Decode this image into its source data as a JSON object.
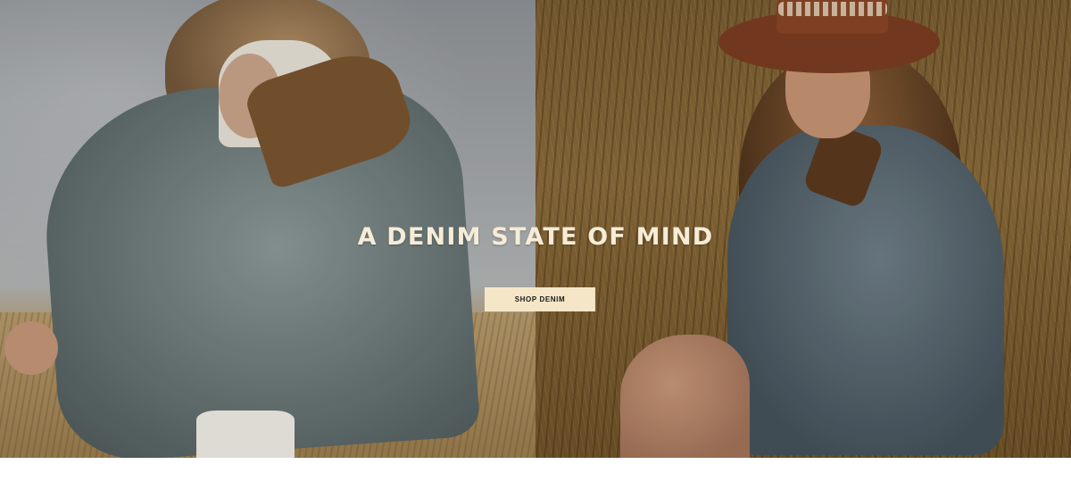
{
  "hero": {
    "headline": "A DENIM STATE OF MIND",
    "cta_label": "SHOP DENIM"
  },
  "images": {
    "left": {
      "icon": "photo-woman-denim-jacket-back-view"
    },
    "right": {
      "icon": "photo-woman-hat-denim-jacket-seated"
    }
  },
  "colors": {
    "headline": "#f6ecd7",
    "cta_background": "#f5e6c8",
    "cta_text": "#1a1a1a"
  }
}
